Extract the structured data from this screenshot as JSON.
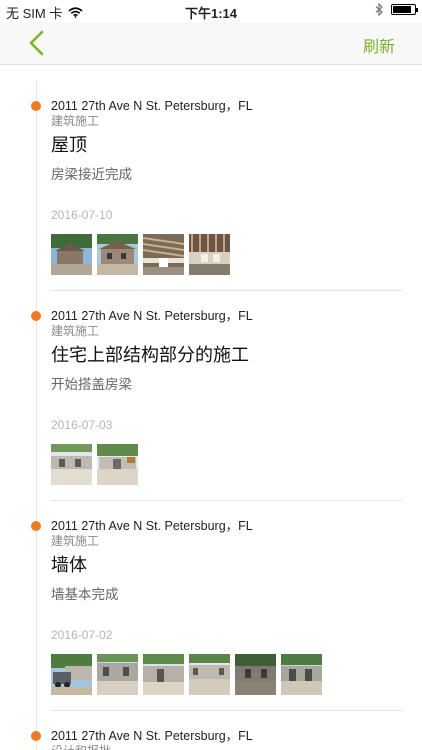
{
  "status": {
    "carrier": "无 SIM 卡",
    "time": "下午1:14"
  },
  "nav": {
    "refresh_label": "刷新"
  },
  "entries": [
    {
      "address": "2011 27th Ave N St. Petersburg，FL",
      "category": "建筑施工",
      "title": "屋顶",
      "description": "房梁接近完成",
      "date": "2016-07-10",
      "photos": [
        "house-exterior-photo",
        "house-exterior-photo",
        "roof-framing-photo",
        "roof-framing-photo"
      ]
    },
    {
      "address": "2011 27th Ave N St. Petersburg，FL",
      "category": "建筑施工",
      "title": "住宅上部结构部分的施工",
      "description": "开始搭盖房梁",
      "date": "2016-07-03",
      "photos": [
        "block-walls-photo",
        "block-walls-photo"
      ]
    },
    {
      "address": "2011 27th Ave N St. Petersburg，FL",
      "category": "建筑施工",
      "title": "墙体",
      "description": "墙基本完成",
      "date": "2016-07-02",
      "photos": [
        "site-truck-photo",
        "block-walls-photo",
        "block-walls-photo",
        "block-walls-photo",
        "block-walls-photo",
        "block-walls-photo"
      ]
    },
    {
      "address": "2011 27th Ave N St. Petersburg，FL",
      "category": "设计和报批"
    }
  ]
}
